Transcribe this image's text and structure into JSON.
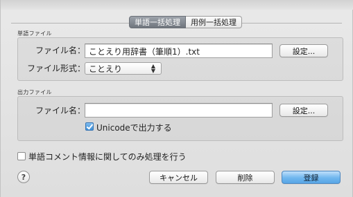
{
  "tabs": [
    {
      "label": "単語一括処理",
      "selected": true
    },
    {
      "label": "用例一括処理",
      "selected": false
    }
  ],
  "word_file": {
    "group_label": "単語ファイル",
    "filename_label": "ファイル名：",
    "filename_value": "ことえり用辞書（筆順1）.txt",
    "format_label": "ファイル形式：",
    "format_value": "ことえり",
    "settings_button": "設定..."
  },
  "output_file": {
    "group_label": "出力ファイル",
    "filename_label": "ファイル名：",
    "filename_value": "",
    "settings_button": "設定...",
    "unicode_checkbox_label": "Unicodeで出力する",
    "unicode_checked": true
  },
  "comment_only_checkbox": {
    "label": "単語コメント情報に関してのみ処理を行う",
    "checked": false
  },
  "footer": {
    "help_label": "?",
    "cancel_button": "キャンセル",
    "delete_button": "削除",
    "register_button": "登録"
  },
  "colors": {
    "default_button": "#6fb6ee",
    "selected_tab": "#7d838b"
  }
}
